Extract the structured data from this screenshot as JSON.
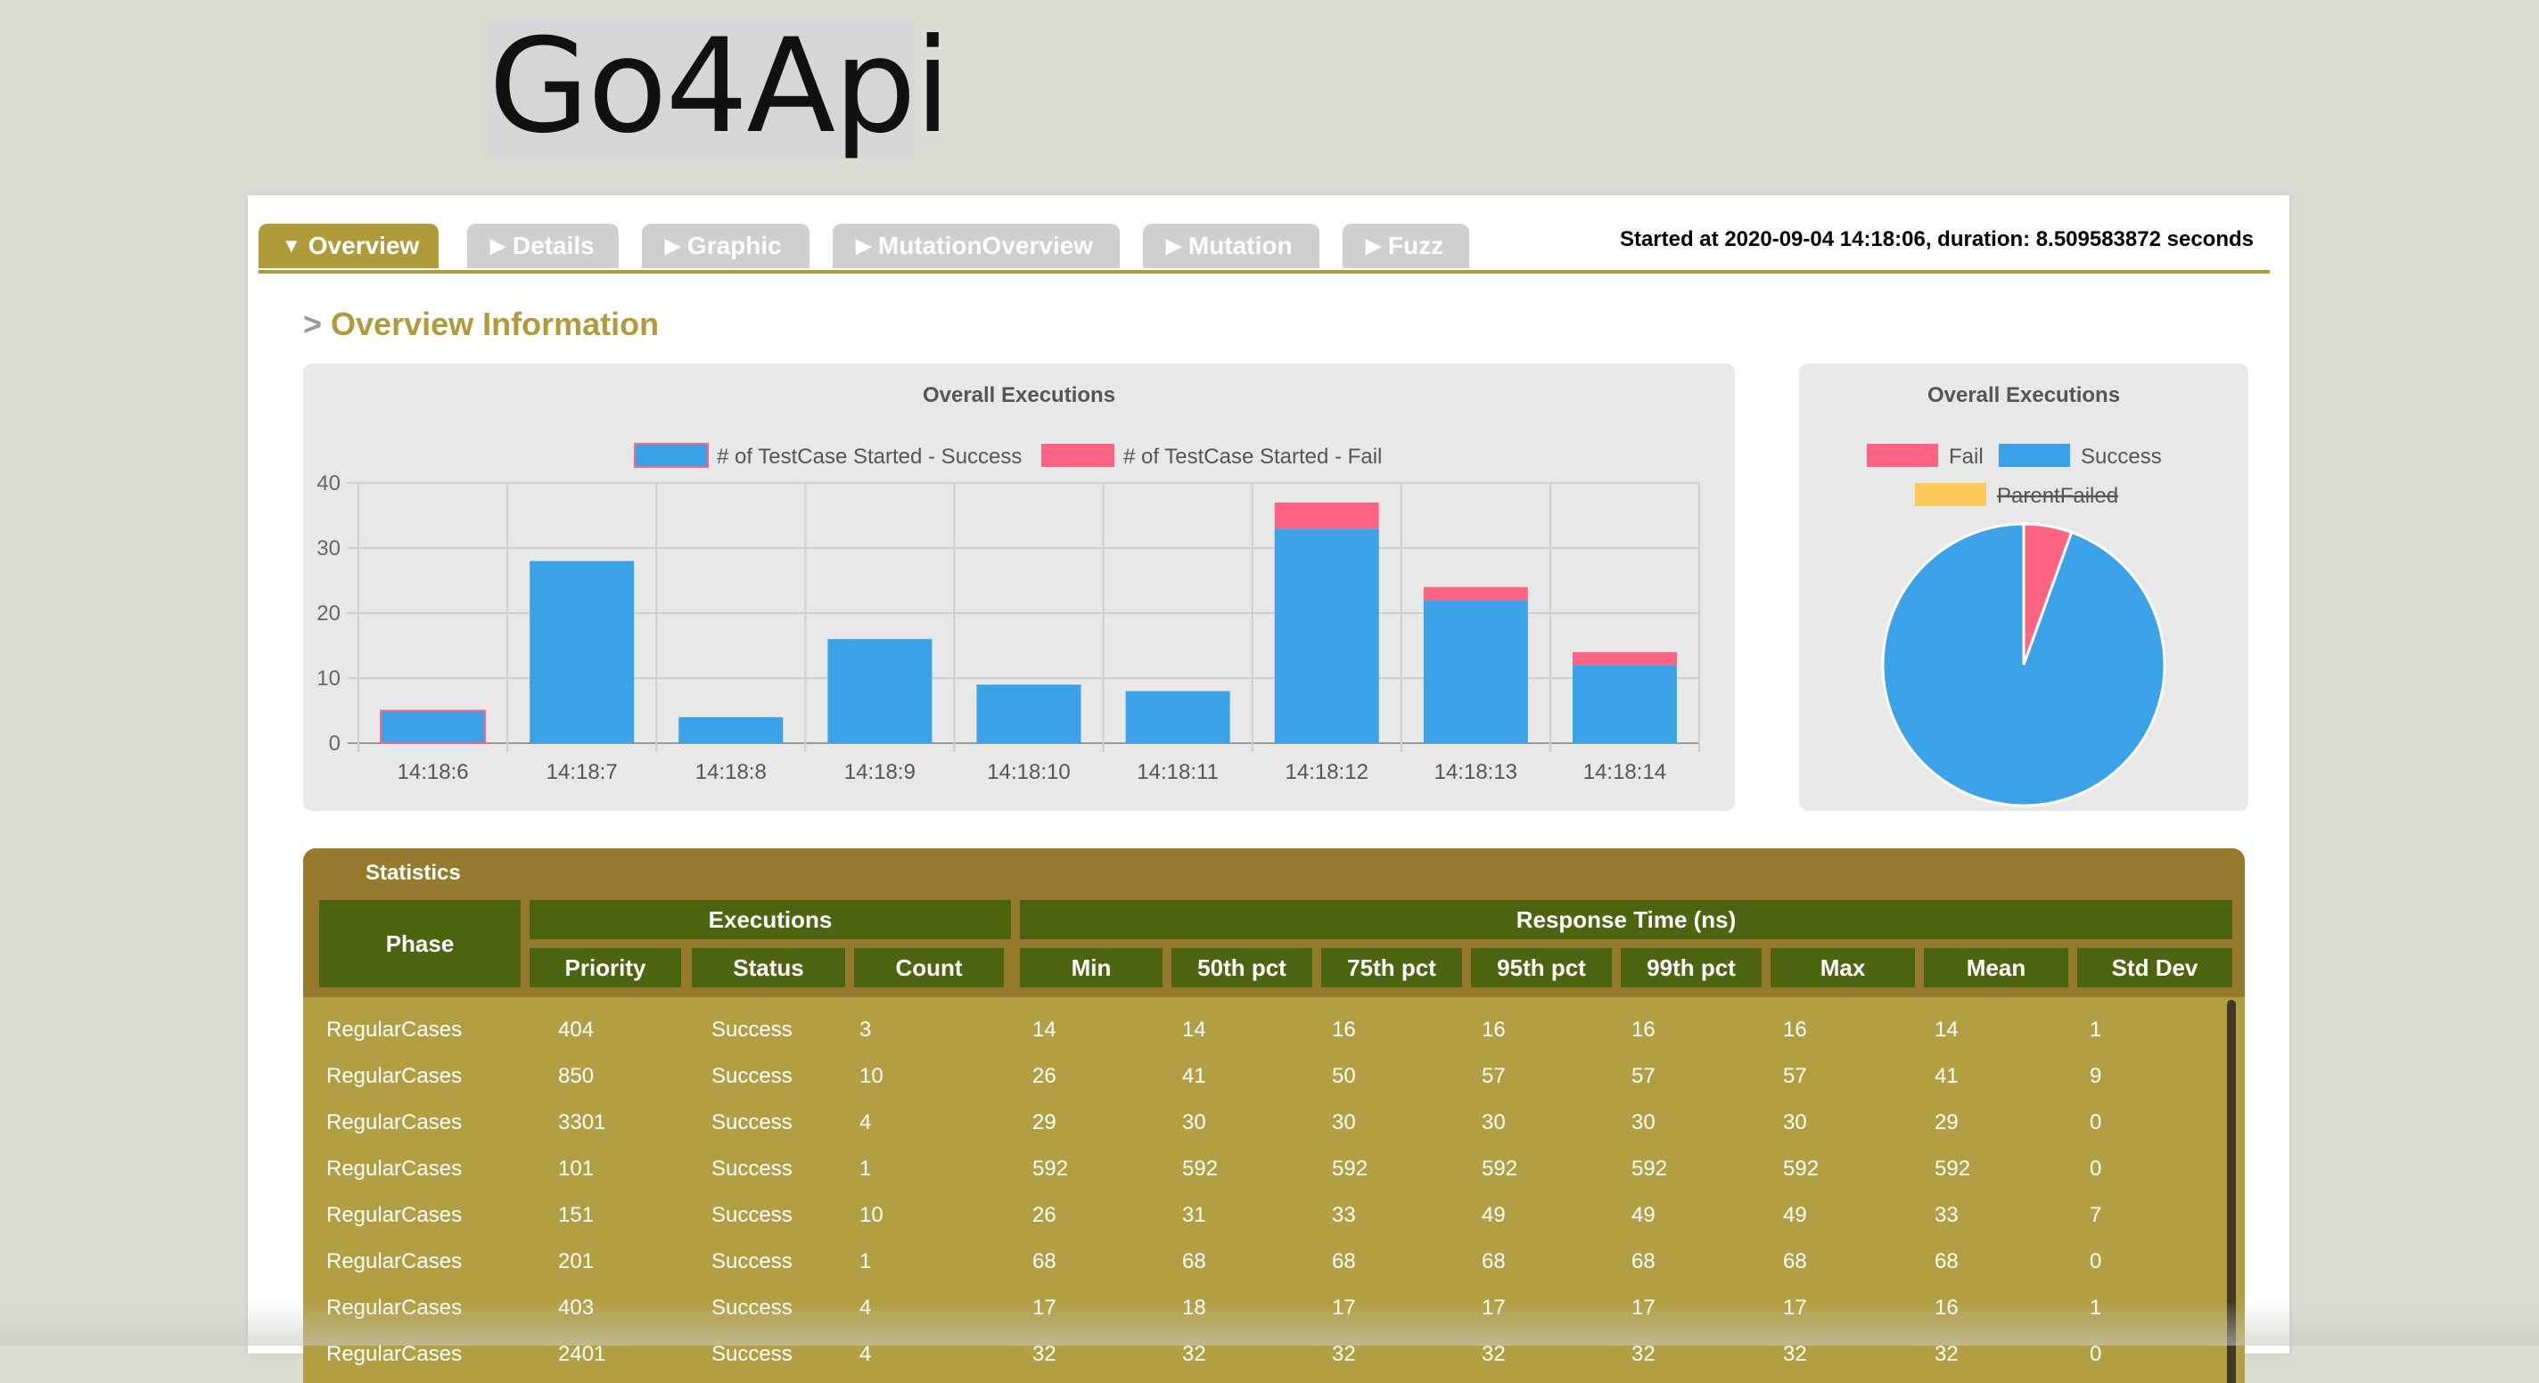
{
  "logo": {
    "text": "Go4Api"
  },
  "tabs": [
    {
      "label": "Overview",
      "active": true
    },
    {
      "label": "Details",
      "active": false
    },
    {
      "label": "Graphic",
      "active": false
    },
    {
      "label": "MutationOverview",
      "active": false
    },
    {
      "label": "Mutation",
      "active": false
    },
    {
      "label": "Fuzz",
      "active": false
    }
  ],
  "status": {
    "started": "Started at 2020-09-04 14:18:06, duration: 8.509583872 seconds"
  },
  "section": {
    "prefix": ">",
    "title": "Overview Information"
  },
  "colors": {
    "accent": "#b09b3b",
    "success": "#3ca2e8",
    "fail": "#fe6384",
    "parent_failed": "#fccb5c",
    "header_green": "#4d6410"
  },
  "chart_data": [
    {
      "type": "bar",
      "title": "Overall Executions",
      "categories": [
        "14:18:6",
        "14:18:7",
        "14:18:8",
        "14:18:9",
        "14:18:10",
        "14:18:11",
        "14:18:12",
        "14:18:13",
        "14:18:14"
      ],
      "series": [
        {
          "name": "# of TestCase Started - Success",
          "color": "#3ca2e8",
          "values": [
            5,
            28,
            4,
            16,
            9,
            8,
            33,
            22,
            12
          ]
        },
        {
          "name": "# of TestCase Started - Fail",
          "color": "#fe6384",
          "values": [
            0,
            0,
            0,
            0,
            0,
            0,
            4,
            2,
            2
          ]
        }
      ],
      "stacked": true,
      "ylim": [
        0,
        40
      ],
      "yticks": [
        0,
        10,
        20,
        30,
        40
      ],
      "grid": true,
      "legend": "top"
    },
    {
      "type": "pie",
      "title": "Overall Executions",
      "labels": [
        "Fail",
        "Success",
        "ParentFailed"
      ],
      "values": [
        8,
        137,
        0
      ],
      "colors": [
        "#fe6384",
        "#3ca2e8",
        "#fccb5c"
      ],
      "hidden": [
        "ParentFailed"
      ],
      "legend": "top"
    }
  ],
  "stats": {
    "title": "Statistics",
    "group_headers": {
      "phase": "Phase",
      "executions": "Executions",
      "response": "Response Time (ns)"
    },
    "columns": [
      "Priority",
      "Status",
      "Count",
      "Min",
      "50th pct",
      "75th pct",
      "95th pct",
      "99th pct",
      "Max",
      "Mean",
      "Std Dev"
    ],
    "rows": [
      [
        "RegularCases",
        "404",
        "Success",
        "3",
        "14",
        "14",
        "16",
        "16",
        "16",
        "16",
        "14",
        "1"
      ],
      [
        "RegularCases",
        "850",
        "Success",
        "10",
        "26",
        "41",
        "50",
        "57",
        "57",
        "57",
        "41",
        "9"
      ],
      [
        "RegularCases",
        "3301",
        "Success",
        "4",
        "29",
        "30",
        "30",
        "30",
        "30",
        "30",
        "29",
        "0"
      ],
      [
        "RegularCases",
        "101",
        "Success",
        "1",
        "592",
        "592",
        "592",
        "592",
        "592",
        "592",
        "592",
        "0"
      ],
      [
        "RegularCases",
        "151",
        "Success",
        "10",
        "26",
        "31",
        "33",
        "49",
        "49",
        "49",
        "33",
        "7"
      ],
      [
        "RegularCases",
        "201",
        "Success",
        "1",
        "68",
        "68",
        "68",
        "68",
        "68",
        "68",
        "68",
        "0"
      ],
      [
        "RegularCases",
        "403",
        "Success",
        "4",
        "17",
        "18",
        "17",
        "17",
        "17",
        "17",
        "16",
        "1"
      ],
      [
        "RegularCases",
        "2401",
        "Success",
        "4",
        "32",
        "32",
        "32",
        "32",
        "32",
        "32",
        "32",
        "0"
      ]
    ]
  }
}
